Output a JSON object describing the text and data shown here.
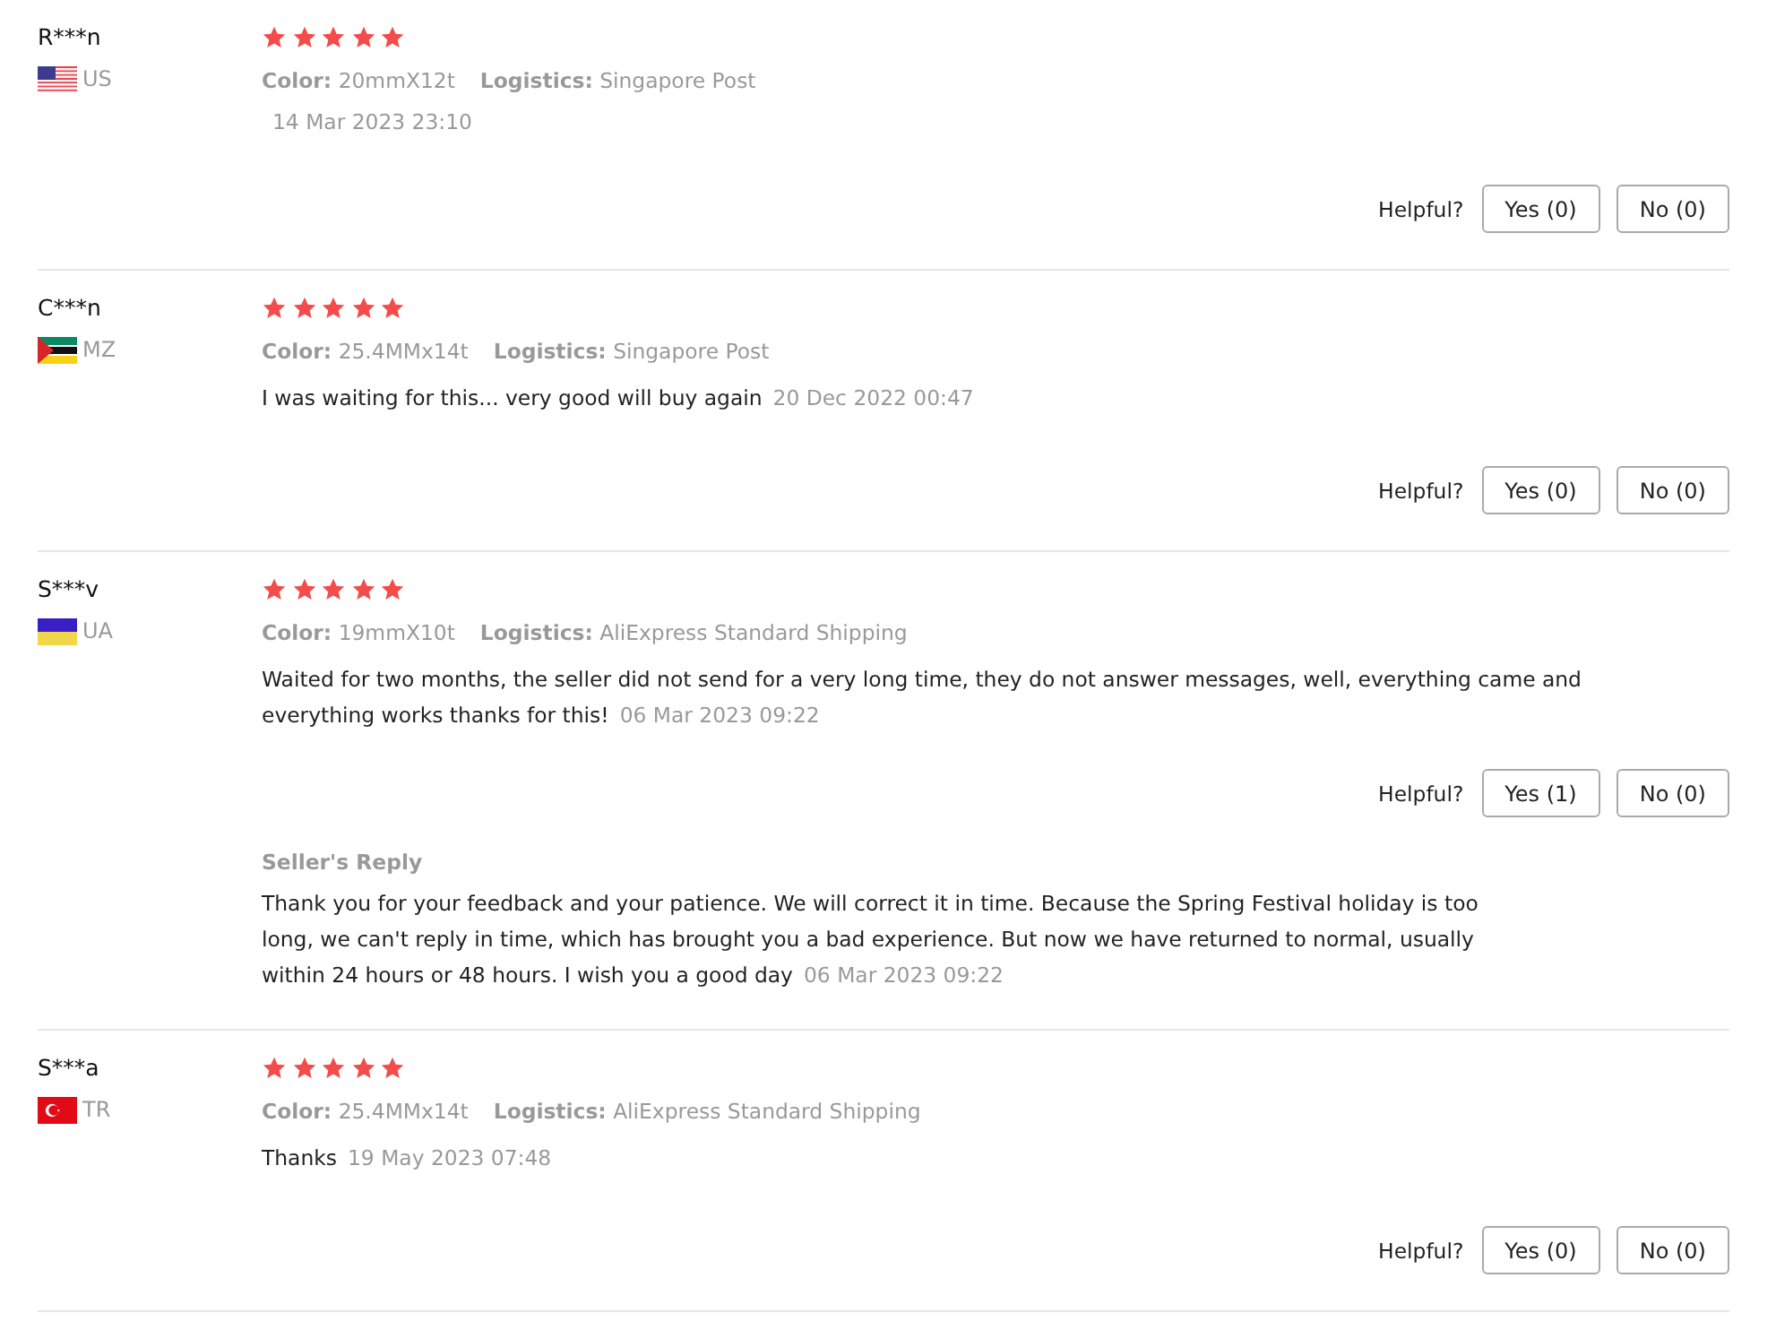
{
  "reviews": [
    {
      "name": "R***n",
      "kind": "us",
      "country": "US",
      "stars": 5,
      "color_label": "Color:",
      "color_value": "20mmX12t",
      "logistics_label": "Logistics:",
      "logistics": "Singapore Post",
      "date": "14 Mar 2023 23:10",
      "helpful_label": "Helpful?",
      "yes": "Yes (0)",
      "no": "No (0)"
    },
    {
      "name": "C***n",
      "kind": "mz",
      "country": "MZ",
      "stars": 5,
      "color_label": "Color:",
      "color_value": "25.4MMx14t",
      "logistics_label": "Logistics:",
      "logistics": "Singapore Post",
      "text": "I was waiting for this... very good will buy again",
      "date": "20 Dec 2022 00:47",
      "helpful_label": "Helpful?",
      "yes": "Yes (0)",
      "no": "No (0)"
    },
    {
      "name": "S***v",
      "kind": "ua",
      "country": "UA",
      "stars": 5,
      "color_label": "Color:",
      "color_value": "19mmX10t",
      "logistics_label": "Logistics:",
      "logistics": "AliExpress Standard Shipping",
      "text": "Waited for two months, the seller did not send for a very long time, they do not answer messages, well, everything came and everything works thanks for this!",
      "date": "06 Mar 2023 09:22",
      "helpful_label": "Helpful?",
      "yes": "Yes (1)",
      "no": "No (0)",
      "seller_reply": {
        "title": "Seller's Reply",
        "text": "Thank you for your feedback and your patience. We will correct it in time. Because the Spring Festival holiday is too long, we can't reply in time, which has brought you a bad experience. But now we have returned to normal, usually within 24 hours or 48 hours. I wish you a good day",
        "date": "06 Mar 2023 09:22"
      }
    },
    {
      "name": "S***a",
      "kind": "tr",
      "country": "TR",
      "stars": 5,
      "color_label": "Color:",
      "color_value": "25.4MMx14t",
      "logistics_label": "Logistics:",
      "logistics": "AliExpress Standard Shipping",
      "text": "Thanks",
      "date": "19 May 2023 07:48",
      "helpful_label": "Helpful?",
      "yes": "Yes (0)",
      "no": "No (0)"
    }
  ]
}
